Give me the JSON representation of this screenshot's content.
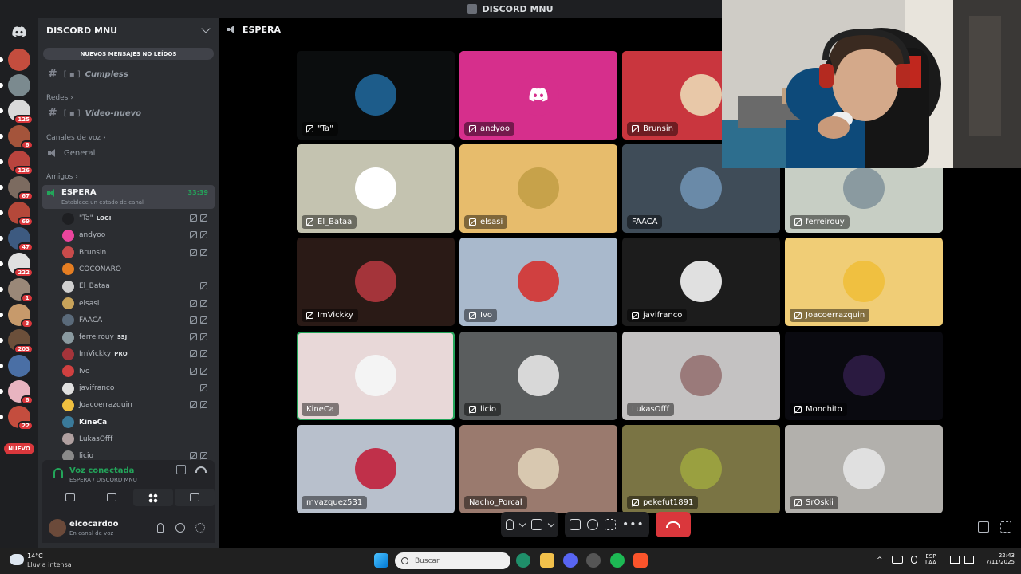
{
  "window": {
    "title": "DISCORD MNU"
  },
  "rail": {
    "servers": [
      {
        "color": "#c44d3e",
        "badge": ""
      },
      {
        "color": "#7b8a8f",
        "badge": ""
      },
      {
        "color": "#d9d9d9",
        "badge": "125"
      },
      {
        "color": "#a4543b",
        "badge": "6"
      },
      {
        "color": "#b9443e",
        "badge": "126"
      },
      {
        "color": "#7c6b60",
        "badge": "67"
      },
      {
        "color": "#b5483a",
        "badge": "69"
      },
      {
        "color": "#3d5a80",
        "badge": "47"
      },
      {
        "color": "#e0e0e0",
        "badge": "222"
      },
      {
        "color": "#9a8878",
        "badge": "1"
      },
      {
        "color": "#c79a6b",
        "badge": "3"
      },
      {
        "color": "#6b4f3a",
        "badge": "203"
      },
      {
        "color": "#4a6fa5",
        "badge": ""
      },
      {
        "color": "#e8b4c0",
        "badge": "6"
      },
      {
        "color": "#c44d3e",
        "badge": "22"
      }
    ],
    "nuevo_label": "NUEVO"
  },
  "sidebar": {
    "guild_name": "DISCORD MNU",
    "unread_pill": "NUEVOS MENSAJES NO LEÍDOS",
    "channels": {
      "cumpless": "Cumpless",
      "redes_cat": "Redes",
      "video_nuevo": "Video-nuevo",
      "voice_cat": "Canales de voz",
      "general": "General",
      "amigos_cat": "Amigos"
    },
    "active_channel": {
      "name": "ESPERA",
      "status": "Establece un estado de canal",
      "timer": "33:39"
    },
    "members": [
      {
        "name": "\"Ta\"",
        "tag": "LOGI",
        "color": "#1e1f22",
        "icons": 2,
        "bold": false
      },
      {
        "name": "andyoo",
        "tag": "",
        "color": "#eb459e",
        "icons": 2,
        "bold": false
      },
      {
        "name": "Brunsin",
        "tag": "",
        "color": "#c94b4b",
        "icons": 2,
        "bold": false
      },
      {
        "name": "COCONARO",
        "tag": "",
        "color": "#e67e22",
        "icons": 0,
        "bold": false
      },
      {
        "name": "El_Bataa",
        "tag": "",
        "color": "#d0d0d0",
        "icons": 1,
        "bold": false
      },
      {
        "name": "elsasi",
        "tag": "",
        "color": "#c8a35a",
        "icons": 2,
        "bold": false
      },
      {
        "name": "FAACA",
        "tag": "",
        "color": "#5a6a7a",
        "icons": 2,
        "bold": false
      },
      {
        "name": "ferreirouy",
        "tag": "SSJ",
        "color": "#8a9aa0",
        "icons": 2,
        "bold": false
      },
      {
        "name": "ImVickky",
        "tag": "PRO",
        "color": "#a4343a",
        "icons": 2,
        "bold": false
      },
      {
        "name": "Ivo",
        "tag": "",
        "color": "#d04040",
        "icons": 2,
        "bold": false
      },
      {
        "name": "javifranco",
        "tag": "",
        "color": "#e0e0e0",
        "icons": 1,
        "bold": false
      },
      {
        "name": "Joacoerrazquin",
        "tag": "",
        "color": "#f0c040",
        "icons": 2,
        "bold": false
      },
      {
        "name": "KineCa",
        "tag": "",
        "color": "#3a7a9a",
        "icons": 0,
        "bold": true
      },
      {
        "name": "LukasOfff",
        "tag": "",
        "color": "#b0a0a0",
        "icons": 0,
        "bold": false
      },
      {
        "name": "licio",
        "tag": "",
        "color": "#8a8a8a",
        "icons": 2,
        "bold": false
      }
    ],
    "voice_panel": {
      "title": "Voz conectada",
      "subtitle": "ESPERA / DISCORD MNU"
    },
    "user": {
      "name": "elcocardoo",
      "status": "En canal de voz"
    }
  },
  "main": {
    "channel_title": "ESPERA",
    "tiles": [
      {
        "name": "\"Ta\"",
        "muted": true,
        "bg": "#0b0d0e",
        "av": "#1d5c8a",
        "speaking": false
      },
      {
        "name": "andyoo",
        "muted": true,
        "bg": "#d62f8c",
        "av": "#d62f8c",
        "speaking": false
      },
      {
        "name": "Brunsin",
        "muted": true,
        "bg": "#c9363e",
        "av": "#e8c8a8",
        "speaking": false
      },
      {
        "name": "",
        "muted": false,
        "bg": "#000000",
        "av": "#000000",
        "speaking": false
      },
      {
        "name": "El_Bataa",
        "muted": true,
        "bg": "#c4c3b0",
        "av": "#ffffff",
        "speaking": false
      },
      {
        "name": "elsasi",
        "muted": true,
        "bg": "#e7bc6c",
        "av": "#c7a24a",
        "speaking": false
      },
      {
        "name": "FAACA",
        "muted": false,
        "bg": "#3f4c58",
        "av": "#6a8aa8",
        "speaking": false
      },
      {
        "name": "ferreirouy",
        "muted": true,
        "bg": "#c7cec4",
        "av": "#8a9aa0",
        "speaking": false
      },
      {
        "name": "ImVickky",
        "muted": true,
        "bg": "#2a1a16",
        "av": "#a4343a",
        "speaking": false
      },
      {
        "name": "Ivo",
        "muted": true,
        "bg": "#a9b9cc",
        "av": "#d04040",
        "speaking": false
      },
      {
        "name": "javifranco",
        "muted": true,
        "bg": "#1c1c1c",
        "av": "#e0e0e0",
        "speaking": false
      },
      {
        "name": "Joacoerrazquin",
        "muted": true,
        "bg": "#f0cd76",
        "av": "#f0c040",
        "speaking": false
      },
      {
        "name": "KineCa",
        "muted": false,
        "bg": "#e8d8d8",
        "av": "#f4f4f4",
        "speaking": true
      },
      {
        "name": "licio",
        "muted": true,
        "bg": "#5a5d5e",
        "av": "#d8d8d8",
        "speaking": false
      },
      {
        "name": "LukasOfff",
        "muted": false,
        "bg": "#c4c2c2",
        "av": "#9a7a7a",
        "speaking": false
      },
      {
        "name": "Monchito",
        "muted": true,
        "bg": "#0a0a10",
        "av": "#2a1a40",
        "speaking": false
      },
      {
        "name": "mvazquez531",
        "muted": false,
        "bg": "#b8c0cc",
        "av": "#c0304a",
        "speaking": false
      },
      {
        "name": "Nacho_Porcal",
        "muted": false,
        "bg": "#9a7a6e",
        "av": "#d8c8b0",
        "speaking": false
      },
      {
        "name": "pekefut1891",
        "muted": true,
        "bg": "#7a7444",
        "av": "#9aa040",
        "speaking": false
      },
      {
        "name": "SrOskii",
        "muted": true,
        "bg": "#b2b0ac",
        "av": "#e0e0e0",
        "speaking": false
      }
    ]
  },
  "taskbar": {
    "weather_temp": "14°C",
    "weather_desc": "Lluvia intensa",
    "search_placeholder": "Buscar",
    "lang_line1": "ESP",
    "lang_line2": "LAA",
    "time": "22:43",
    "date": "7/11/2025"
  }
}
